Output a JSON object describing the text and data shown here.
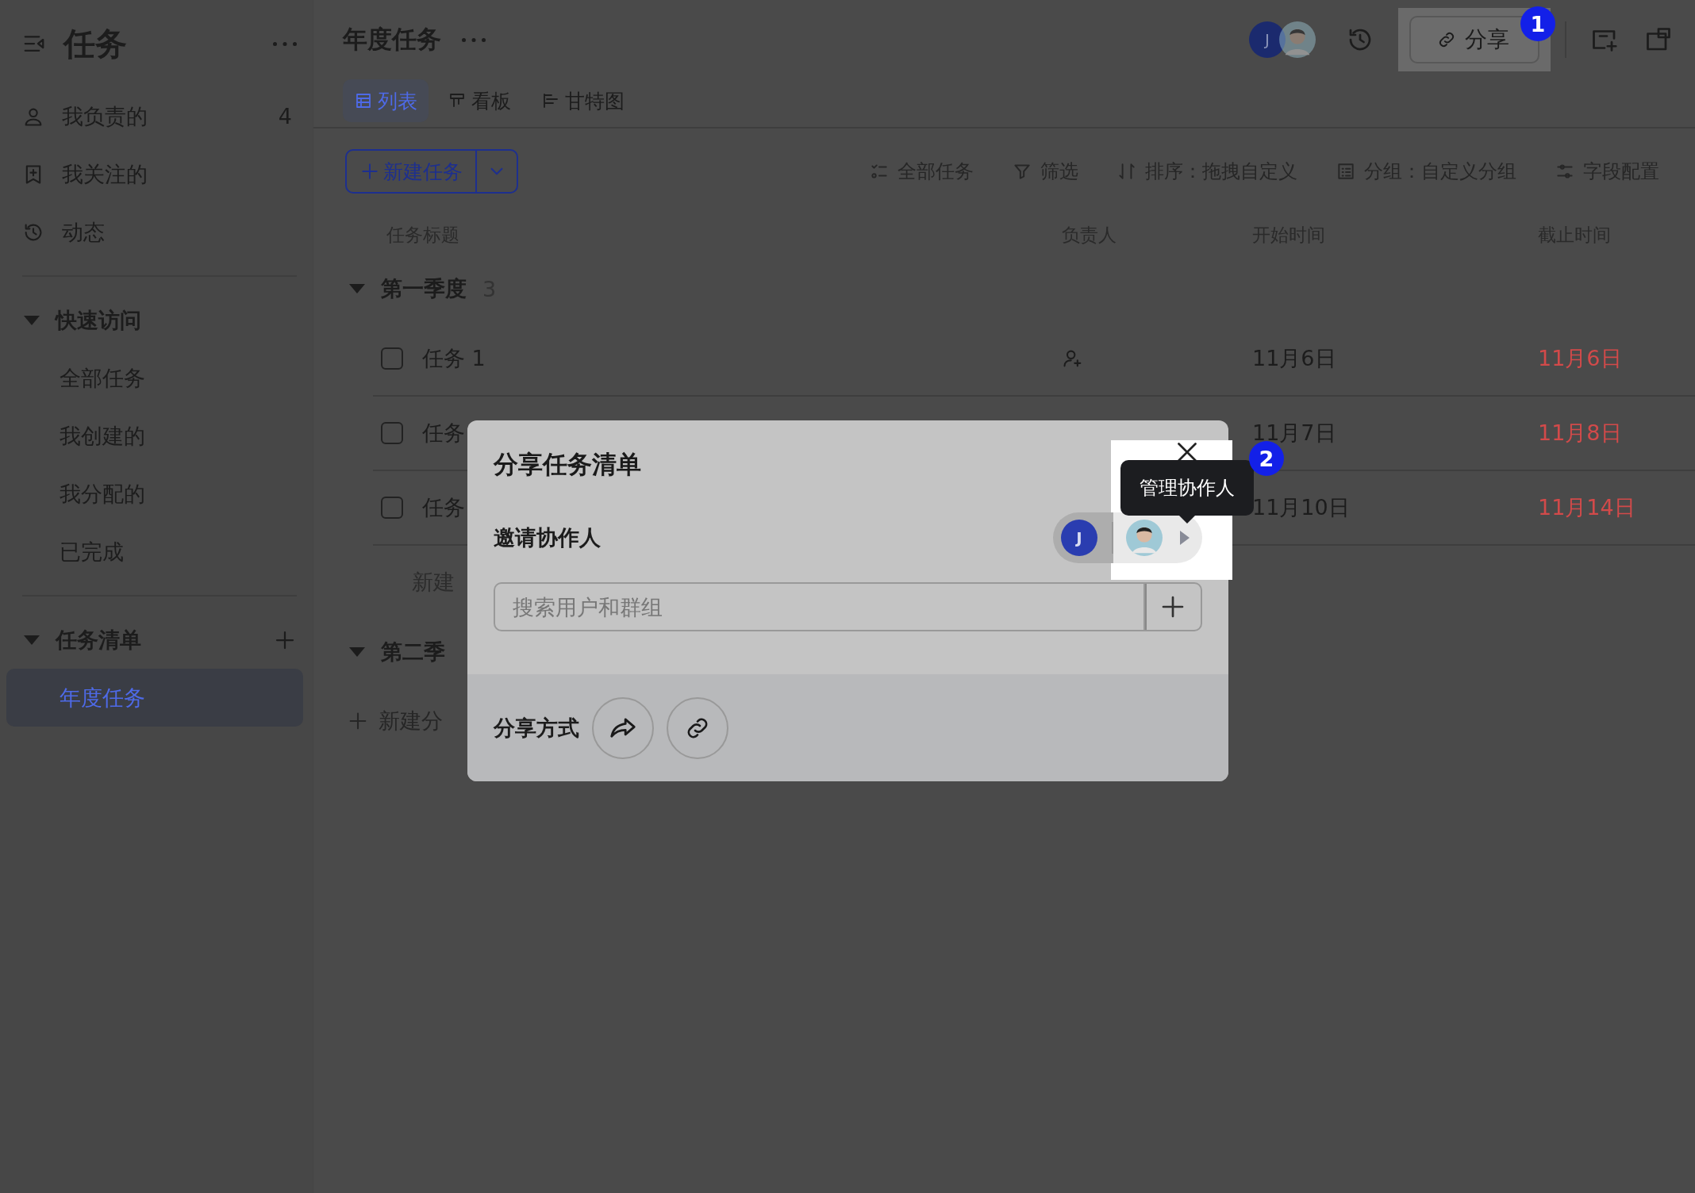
{
  "sidebar": {
    "title": "任务",
    "items": [
      {
        "label": "我负责的",
        "count": "4"
      },
      {
        "label": "我关注的"
      },
      {
        "label": "动态"
      }
    ],
    "sections": [
      {
        "title": "快速访问",
        "expanded": true,
        "addable": false,
        "items": [
          {
            "label": "全部任务",
            "selected": false
          },
          {
            "label": "我创建的",
            "selected": false
          },
          {
            "label": "我分配的",
            "selected": false
          },
          {
            "label": "已完成",
            "selected": false
          }
        ]
      },
      {
        "title": "任务清单",
        "expanded": true,
        "addable": true,
        "items": [
          {
            "label": "年度任务",
            "selected": true
          }
        ]
      }
    ]
  },
  "header": {
    "title": "年度任务",
    "avatar_initial": "J",
    "share_button": "分享"
  },
  "tabs": [
    {
      "label": "列表",
      "selected": true
    },
    {
      "label": "看板",
      "selected": false
    },
    {
      "label": "甘特图",
      "selected": false
    }
  ],
  "toolbar": {
    "new_task": "新建任务",
    "actions": [
      "全部任务",
      "筛选",
      "排序：拖拽自定义",
      "分组：自定义分组",
      "字段配置"
    ]
  },
  "table": {
    "columns": [
      "任务标题",
      "负责人",
      "开始时间",
      "截止时间"
    ],
    "groups": [
      {
        "name": "第一季度",
        "count": "3",
        "expanded": true,
        "new_row": "新建",
        "rows": [
          {
            "title": "任务 1",
            "done": false,
            "start": "11月6日",
            "due": "11月6日",
            "overdue": true
          },
          {
            "title": "任务",
            "done": false,
            "start": "11月7日",
            "due": "11月8日",
            "overdue": true
          },
          {
            "title": "任务",
            "done": false,
            "start": "11月10日",
            "due": "11月14日",
            "overdue": true
          }
        ]
      },
      {
        "name": "第二季",
        "expanded": true
      }
    ],
    "add_group": "新建分"
  },
  "dialog": {
    "title": "分享任务清单",
    "invite_label": "邀请协作人",
    "avatar_initial": "J",
    "search_placeholder": "搜索用户和群组",
    "share_label": "分享方式",
    "tooltip": "管理协作人"
  },
  "badges": [
    "1",
    "2"
  ]
}
